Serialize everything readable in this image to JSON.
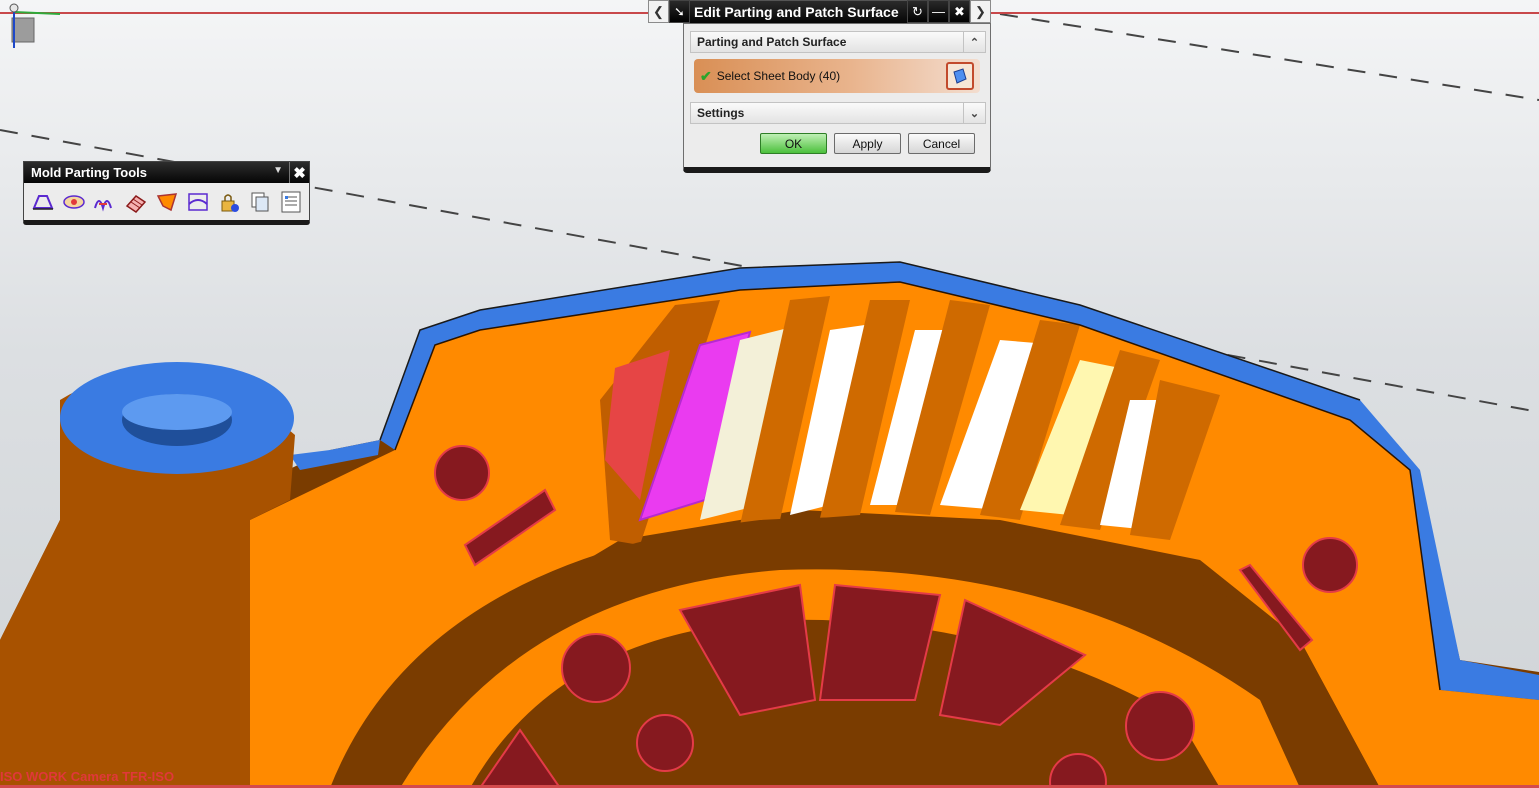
{
  "dialog": {
    "title": "Edit Parting and Patch Surface",
    "group_title": "Parting and Patch Surface",
    "select_label": "Select Sheet Body (40)",
    "settings_label": "Settings",
    "buttons": {
      "ok": "OK",
      "apply": "Apply",
      "cancel": "Cancel"
    }
  },
  "toolbar": {
    "title": "Mold Parting Tools",
    "tools": [
      "region-analysis-icon",
      "design-region-icon",
      "curve-patch-icon",
      "mesh-surface-icon",
      "extend-surface-icon",
      "parting-surface-icon",
      "lock-check-icon",
      "copy-icon",
      "list-icon"
    ]
  },
  "viewport": {
    "camera_label": "ISO WORK Camera TFR-ISO"
  },
  "colors": {
    "accent_orange": "#ff8a00",
    "dark_brown": "#7a3c00",
    "blue_surface": "#3a7be2",
    "red_face": "#86191f",
    "magenta": "#ea3bf0",
    "ok_green": "#4cc03c"
  }
}
